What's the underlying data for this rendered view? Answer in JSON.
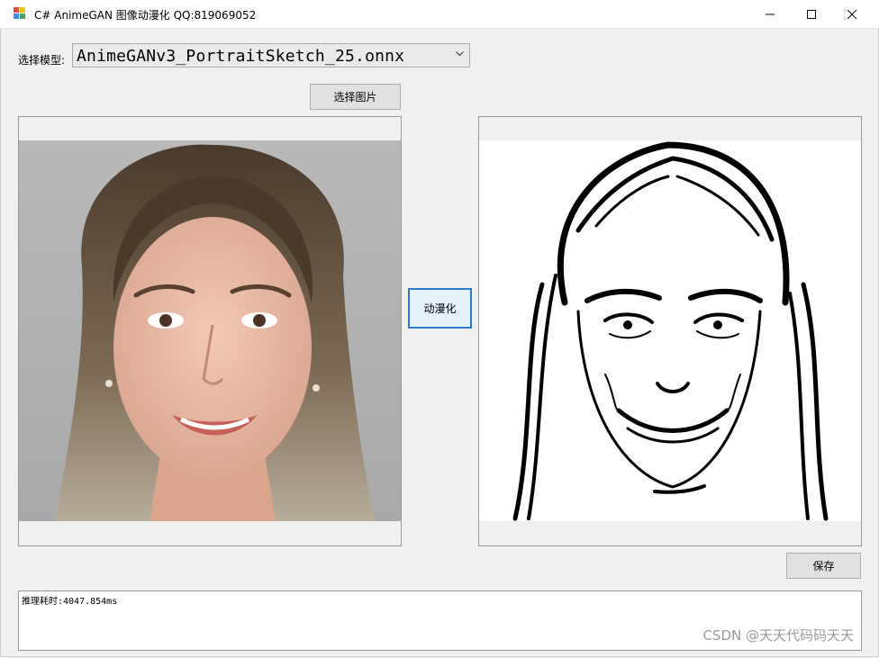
{
  "window": {
    "title": "C# AnimeGAN 图像动漫化 QQ:819069052",
    "controls": [
      "minimize-icon",
      "maximize-icon",
      "close-icon"
    ]
  },
  "model": {
    "label": "选择模型:",
    "selected": "AnimeGANv3_PortraitSketch_25.onnx"
  },
  "buttons": {
    "select_image": "选择图片",
    "animate": "动漫化",
    "save": "保存"
  },
  "images": {
    "source": "portrait-photo",
    "result": "portrait-sketch"
  },
  "log": {
    "text": "推理耗时:4047.854ms"
  },
  "watermark": "CSDN @天天代码码天天",
  "colors": {
    "accent_border": "#2b7bd0",
    "window_bg": "#f0f0f0"
  }
}
